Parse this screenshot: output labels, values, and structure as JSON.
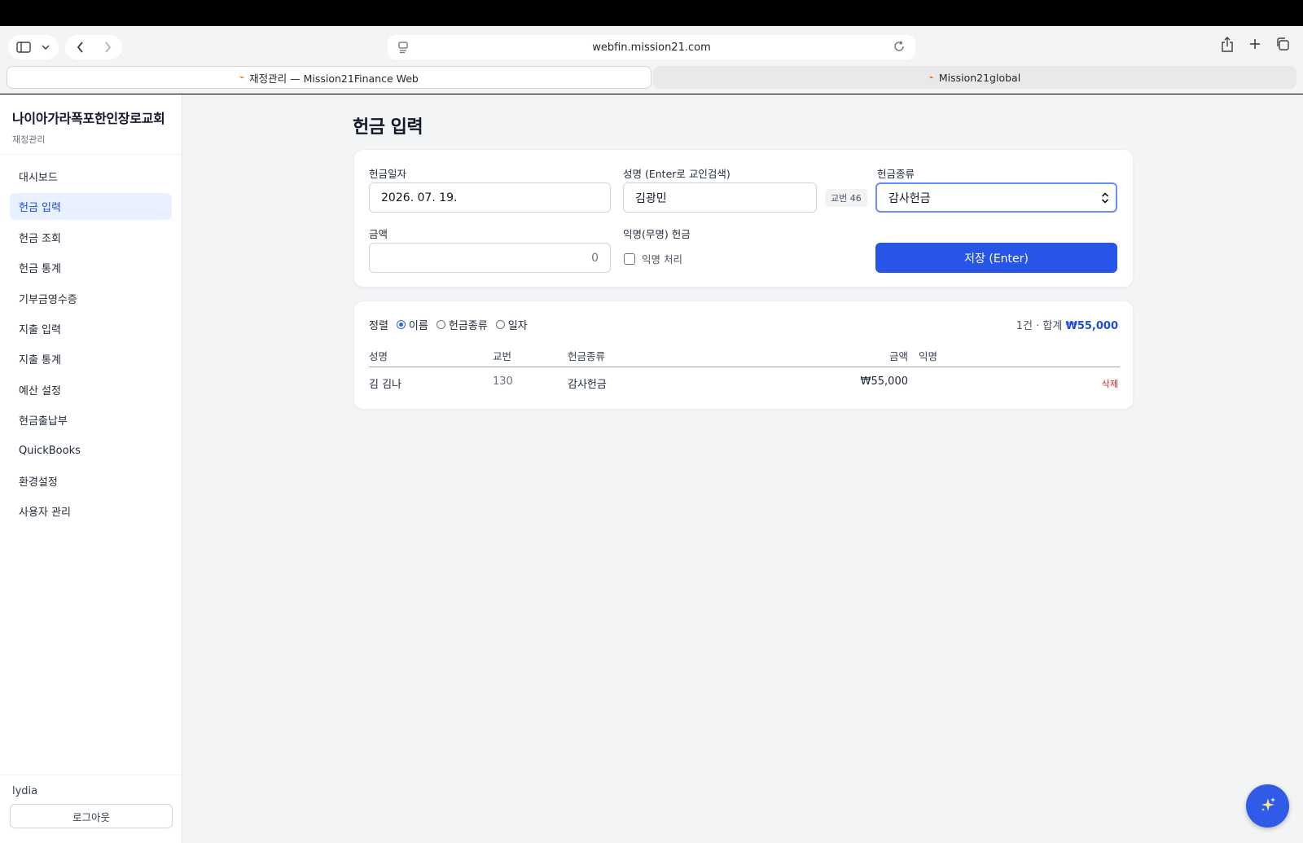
{
  "browser": {
    "url": "webfin.mission21.com",
    "tabs": [
      {
        "title": "재정관리 — Mission21Finance Web",
        "active": true
      },
      {
        "title": "Mission21global",
        "active": false
      }
    ]
  },
  "sidebar": {
    "org_name": "나이아가라폭포한인장로교회",
    "org_sub": "재정관리",
    "items": [
      {
        "label": "대시보드"
      },
      {
        "label": "헌금 입력",
        "active": true
      },
      {
        "label": "헌금 조회"
      },
      {
        "label": "헌금 통계"
      },
      {
        "label": "기부금영수증"
      },
      {
        "label": "지출 입력"
      },
      {
        "label": "지출 통계"
      },
      {
        "label": "예산 설정"
      },
      {
        "label": "현금출납부"
      },
      {
        "label": "QuickBooks"
      },
      {
        "label": "환경설정"
      },
      {
        "label": "사용자 관리"
      }
    ],
    "user": "lydia",
    "logout_label": "로그아웃"
  },
  "page": {
    "title": "헌금 입력"
  },
  "form": {
    "date_label": "헌금일자",
    "date_value": "2026. 07. 19.",
    "name_label": "성명 (Enter로 교인검색)",
    "name_value": "김광민",
    "member_badge": "교번 46",
    "type_label": "헌금종류",
    "type_value": "감사헌금",
    "amount_label": "금액",
    "amount_placeholder": "0",
    "anon_label": "익명(무명) 헌금",
    "anon_checkbox_label": "익명 처리",
    "anon_checked": false,
    "save_label": "저장 (Enter)"
  },
  "list": {
    "sort_label": "정렬",
    "sort_options": [
      {
        "label": "이름",
        "checked": true
      },
      {
        "label": "헌금종류",
        "checked": false
      },
      {
        "label": "일자",
        "checked": false
      }
    ],
    "summary_prefix": "1건 · 합계",
    "summary_total": "₩55,000",
    "columns": {
      "name": "성명",
      "member": "교번",
      "type": "헌금종류",
      "amount": "금액",
      "anon": "익명"
    },
    "rows": [
      {
        "name": "김 김나",
        "member": "130",
        "type": "감사헌금",
        "amount": "₩55,000",
        "anon": "",
        "delete_label": "삭제"
      }
    ]
  },
  "colors": {
    "accent": "#2755e8",
    "active_nav_bg": "#e8efff",
    "danger": "#dc2626"
  },
  "icons": {
    "fab": "sparkles-icon"
  }
}
